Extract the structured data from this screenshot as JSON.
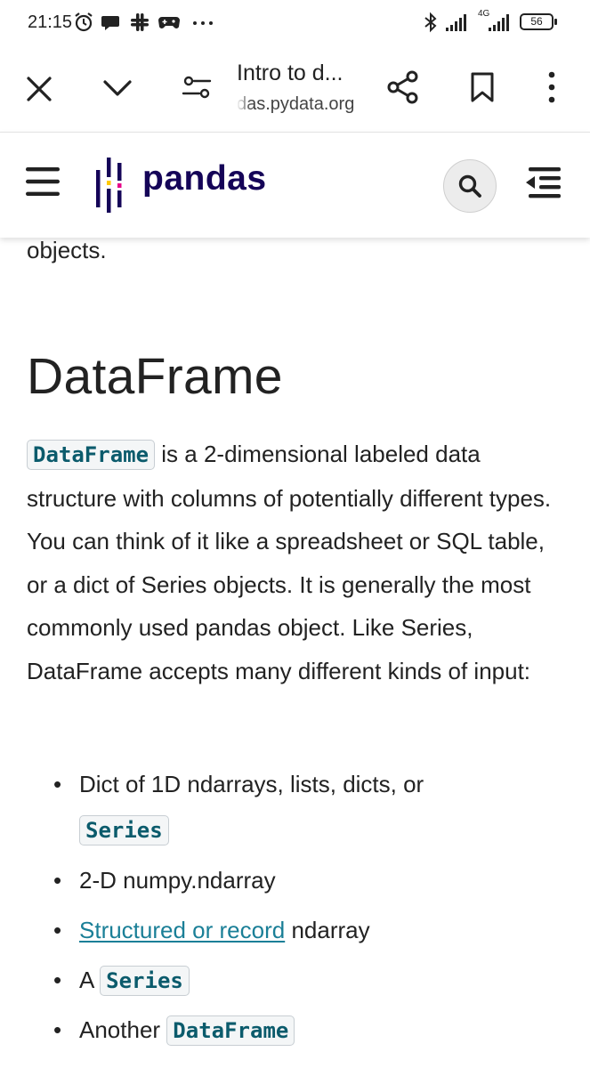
{
  "status_bar": {
    "time": "21:15",
    "network": "4G",
    "battery": "56",
    "icons": [
      "alarm-icon",
      "chat-bubble-icon",
      "slack-icon",
      "game-controller-icon",
      "more-notifications-icon",
      "bluetooth-icon",
      "signal-icon",
      "signal-4g-icon",
      "battery-icon"
    ]
  },
  "browser": {
    "page_title": "Intro to d...",
    "url_host": "das.pydata.org",
    "buttons": [
      "close-icon",
      "chevron-down-icon",
      "site-settings-icon",
      "share-icon",
      "bookmark-icon",
      "menu-more-icon"
    ]
  },
  "site_header": {
    "logo_text": "pandas",
    "icons": [
      "hamburger-menu-icon",
      "pandas-logo-icon",
      "search-icon",
      "toc-icon"
    ]
  },
  "content": {
    "objects_line": "objects.",
    "heading": "DataFrame",
    "para_code": "DataFrame",
    "para_text": " is a 2-dimensional labeled data structure with columns of potentially different types. You can think of it like a spreadsheet or SQL table, or a dict of Series objects. It is generally the most commonly used pandas object. Like Series, DataFrame accepts many different kinds of input:",
    "list": {
      "item1_text": "Dict of 1D ndarrays, lists, dicts, or",
      "item1_code": "Series",
      "item2_text": "2-D numpy.ndarray",
      "item3_link": "Structured or record",
      "item3_text": " ndarray",
      "item4_text": "A ",
      "item4_code": "Series",
      "item5_text": "Another ",
      "item5_code": "DataFrame"
    }
  },
  "colors": {
    "pandas_navy": "#150458",
    "link_teal": "#1a7f97",
    "code_teal": "#0b5b6c"
  }
}
